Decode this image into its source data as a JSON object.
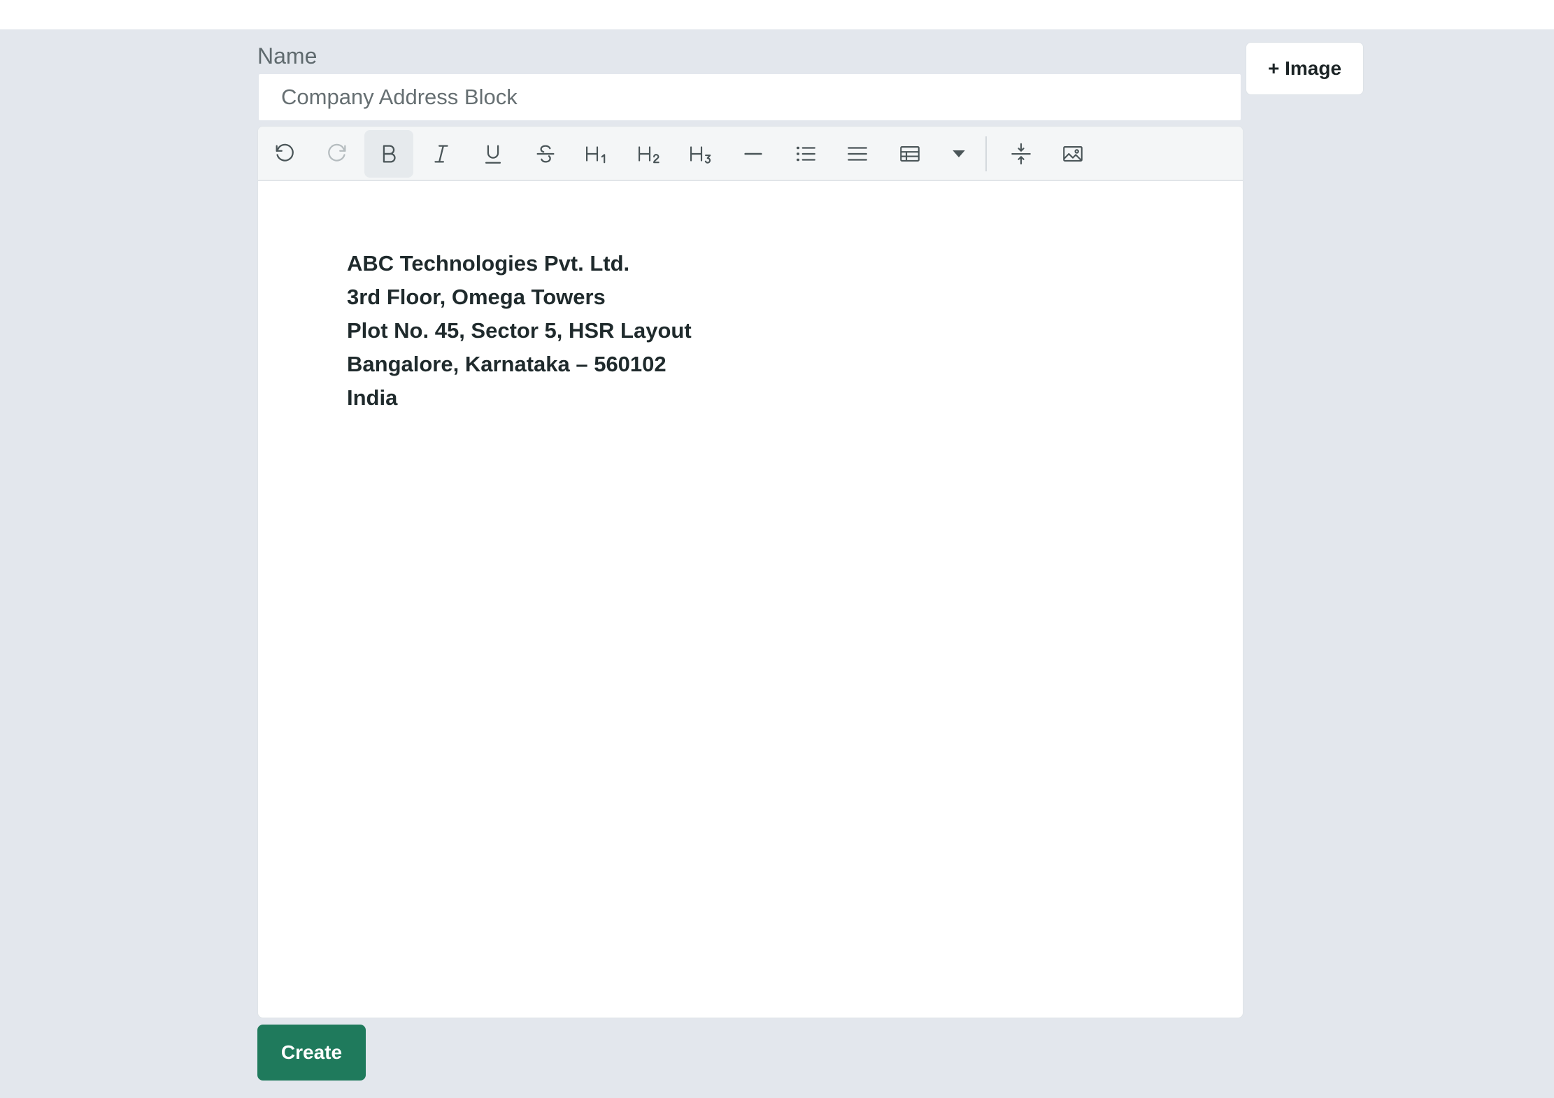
{
  "form": {
    "name_label": "Name",
    "name_value": "Company Address Block",
    "image_button_label": "+ Image",
    "create_button_label": "Create"
  },
  "toolbar": {
    "items": [
      {
        "name": "undo",
        "icon": "undo-icon",
        "active": false,
        "disabled": false
      },
      {
        "name": "redo",
        "icon": "redo-icon",
        "active": false,
        "disabled": true
      },
      {
        "name": "bold",
        "icon": "bold-icon",
        "active": true,
        "disabled": false
      },
      {
        "name": "italic",
        "icon": "italic-icon",
        "active": false,
        "disabled": false
      },
      {
        "name": "underline",
        "icon": "underline-icon",
        "active": false,
        "disabled": false
      },
      {
        "name": "strikethrough",
        "icon": "strikethrough-icon",
        "active": false,
        "disabled": false
      },
      {
        "name": "heading-1",
        "icon": "heading-1-icon",
        "active": false,
        "disabled": false
      },
      {
        "name": "heading-2",
        "icon": "heading-2-icon",
        "active": false,
        "disabled": false
      },
      {
        "name": "heading-3",
        "icon": "heading-3-icon",
        "active": false,
        "disabled": false
      },
      {
        "name": "horizontal-rule",
        "icon": "horizontal-rule-icon",
        "active": false,
        "disabled": false
      },
      {
        "name": "bullet-list",
        "icon": "bullet-list-icon",
        "active": false,
        "disabled": false
      },
      {
        "name": "align",
        "icon": "align-icon",
        "active": false,
        "disabled": false
      },
      {
        "name": "table",
        "icon": "table-icon",
        "active": false,
        "disabled": false
      },
      {
        "name": "table-options",
        "icon": "caret-down-icon",
        "active": false,
        "disabled": false
      },
      {
        "name": "page-break",
        "icon": "page-break-icon",
        "active": false,
        "disabled": false
      },
      {
        "name": "insert-image",
        "icon": "image-icon",
        "active": false,
        "disabled": false
      }
    ]
  },
  "editor": {
    "lines": [
      "ABC Technologies Pvt. Ltd.",
      "3rd Floor, Omega Towers",
      "Plot No. 45, Sector 5, HSR Layout",
      "Bangalore, Karnataka – 560102",
      "India"
    ]
  },
  "colors": {
    "page_background": "#e3e7ed",
    "primary_button": "#1f7a5c",
    "text": "#1f2a2c",
    "muted_text": "#5f6a6e",
    "icon": "#4a5558",
    "icon_disabled": "#b5bcbf"
  }
}
